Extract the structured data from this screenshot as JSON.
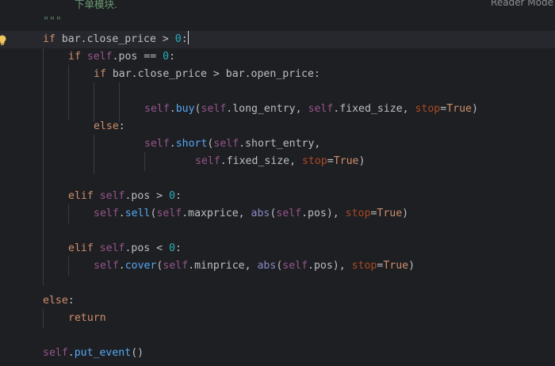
{
  "editor": {
    "reader_mode_label": "Reader Mode",
    "comment_line": "下单模块.",
    "docstring_end": "\"\"\"",
    "cond": {
      "kw": "if",
      "lhs": "bar.close_price",
      "op": " > ",
      "num": "0",
      "colon": ":"
    },
    "pos_check": {
      "kw": "if",
      "self": "self",
      "rest": ".pos == ",
      "num": "0",
      "colon": ":"
    },
    "inner_if": {
      "kw": "if",
      "text": "bar.close_price > bar.open_price:"
    },
    "buy_call": {
      "self1": "self",
      "dot": ".",
      "fn": "buy",
      "open": "(",
      "self2": "self",
      "arg1": ".long_entry, ",
      "self3": "self",
      "arg2": ".fixed_size, ",
      "param": "stop",
      "eq": "=",
      "val": "True",
      "close": ")"
    },
    "else_inner": {
      "kw": "else",
      "colon": ":"
    },
    "short_call": {
      "self1": "self",
      "dot": ".",
      "fn": "short",
      "open": "(",
      "self2": "self",
      "arg1": ".short_entry,"
    },
    "short_cont": {
      "self": "self",
      "arg": ".fixed_size, ",
      "param": "stop",
      "eq": "=",
      "val": "True",
      "close": ")"
    },
    "elif_gt": {
      "kw": "elif",
      "self": "self",
      "rest": ".pos > ",
      "num": "0",
      "colon": ":"
    },
    "sell_call": {
      "self1": "self",
      "dot": ".",
      "fn": "sell",
      "open": "(",
      "self2": "self",
      "arg1": ".maxprice, ",
      "builtin": "abs",
      "p1": "(",
      "self3": "self",
      "arg2": ".pos), ",
      "param": "stop",
      "eq": "=",
      "val": "True",
      "close": ")"
    },
    "elif_lt": {
      "kw": "elif",
      "self": "self",
      "rest": ".pos < ",
      "num": "0",
      "colon": ":"
    },
    "cover_call": {
      "self1": "self",
      "dot": ".",
      "fn": "cover",
      "open": "(",
      "self2": "self",
      "arg1": ".minprice, ",
      "builtin": "abs",
      "p1": "(",
      "self3": "self",
      "arg2": ".pos), ",
      "param": "stop",
      "eq": "=",
      "val": "True",
      "close": ")"
    },
    "else_outer": {
      "kw": "else",
      "colon": ":"
    },
    "return_stmt": {
      "kw": "return"
    },
    "put_event": {
      "self": "self",
      "dot": ".",
      "fn": "put_event",
      "parens": "()"
    }
  },
  "colors": {
    "background": "#1e1f22",
    "keyword": "#cf8e6d",
    "self": "#94558d",
    "function": "#56a8f5",
    "param": "#aa4926",
    "number": "#2aacb8",
    "builtin": "#8888c6",
    "docstring": "#5f826b",
    "text": "#bcbec4"
  },
  "icons": {
    "gutter_hint": "lightbulb-icon"
  }
}
